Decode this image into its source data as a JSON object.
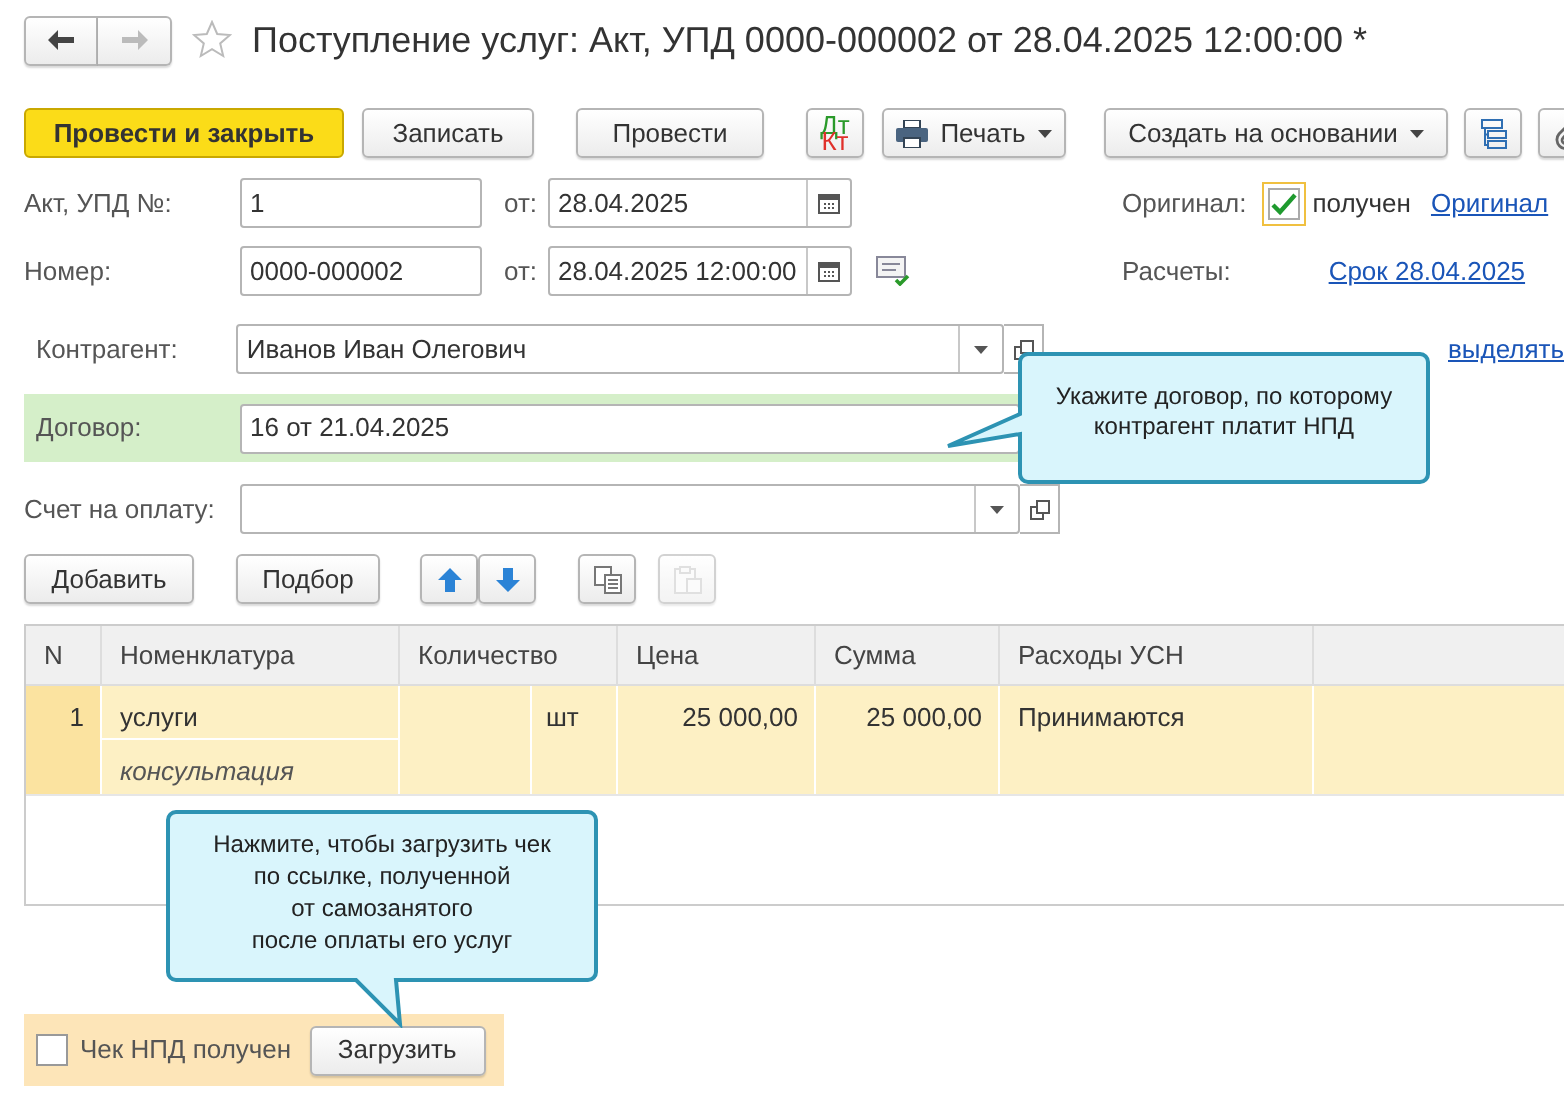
{
  "window": {
    "title": "Поступление услуг: Акт, УПД 0000-000002 от 28.04.2025 12:00:00 *",
    "favorite": false
  },
  "toolbar": [
    {
      "label": "Провести и закрыть",
      "kind": "primary"
    },
    {
      "label": "Записать",
      "kind": "plain"
    },
    {
      "label": "Провести",
      "kind": "plain"
    },
    {
      "kind": "dtkt"
    },
    {
      "label": "Печать",
      "kind": "print"
    },
    {
      "label": "Создать на основании",
      "kind": "menu"
    },
    {
      "kind": "structure"
    },
    {
      "kind": "attach"
    }
  ],
  "dtkt": {
    "dt": "Дт",
    "kt": "Кт"
  },
  "act": {
    "label": "Акт, УПД №:",
    "value": "1",
    "date_label": "от:",
    "date": "28.04.2025"
  },
  "original": {
    "label": "Оригинал:",
    "checked": true,
    "text": "получен",
    "link": "Оригинал"
  },
  "number": {
    "label": "Номер:",
    "value": "0000-000002",
    "date_label": "от:",
    "date": "28.04.2025 12:00:00"
  },
  "payments": {
    "label": "Расчеты:",
    "link": "Срок 28.04.2025"
  },
  "counterparty": {
    "label": "Контрагент:",
    "value": "Иванов Иван Олегович",
    "vat_link": "выделять"
  },
  "contract": {
    "label": "Договор:",
    "value": "16 от 21.04.2025",
    "highlighted": true
  },
  "invoice": {
    "label": "Счет на оплату:"
  },
  "table_buttons": [
    {
      "label": "Добавить",
      "kind": "text",
      "disabled": false
    },
    {
      "label": "Подбор",
      "kind": "text",
      "disabled": false
    },
    {
      "kind": "up",
      "disabled": false
    },
    {
      "kind": "down",
      "disabled": false
    },
    {
      "kind": "copy",
      "disabled": false
    },
    {
      "kind": "paste",
      "disabled": true
    }
  ],
  "table": {
    "columns": [
      "N",
      "Номенклатура",
      "Количество",
      "Цена",
      "Сумма",
      "Расходы УСН"
    ],
    "rows": [
      {
        "n": "1",
        "item": "услуги",
        "content": "консультация",
        "unit": "шт",
        "price": "25 000,00",
        "sum": "25 000,00",
        "expenses": "Принимаются",
        "selected": true
      }
    ]
  },
  "receipt": {
    "label": "Чек НПД получен",
    "checked": false,
    "button": "Загрузить"
  },
  "hints": [
    {
      "lines": [
        "Укажите договор, по которому",
        "контрагент платит НПД"
      ]
    },
    {
      "lines": [
        "Нажмите, чтобы загрузить чек",
        "по ссылке, полученной",
        "от самозанятого",
        "после оплаты его услуг"
      ]
    }
  ]
}
